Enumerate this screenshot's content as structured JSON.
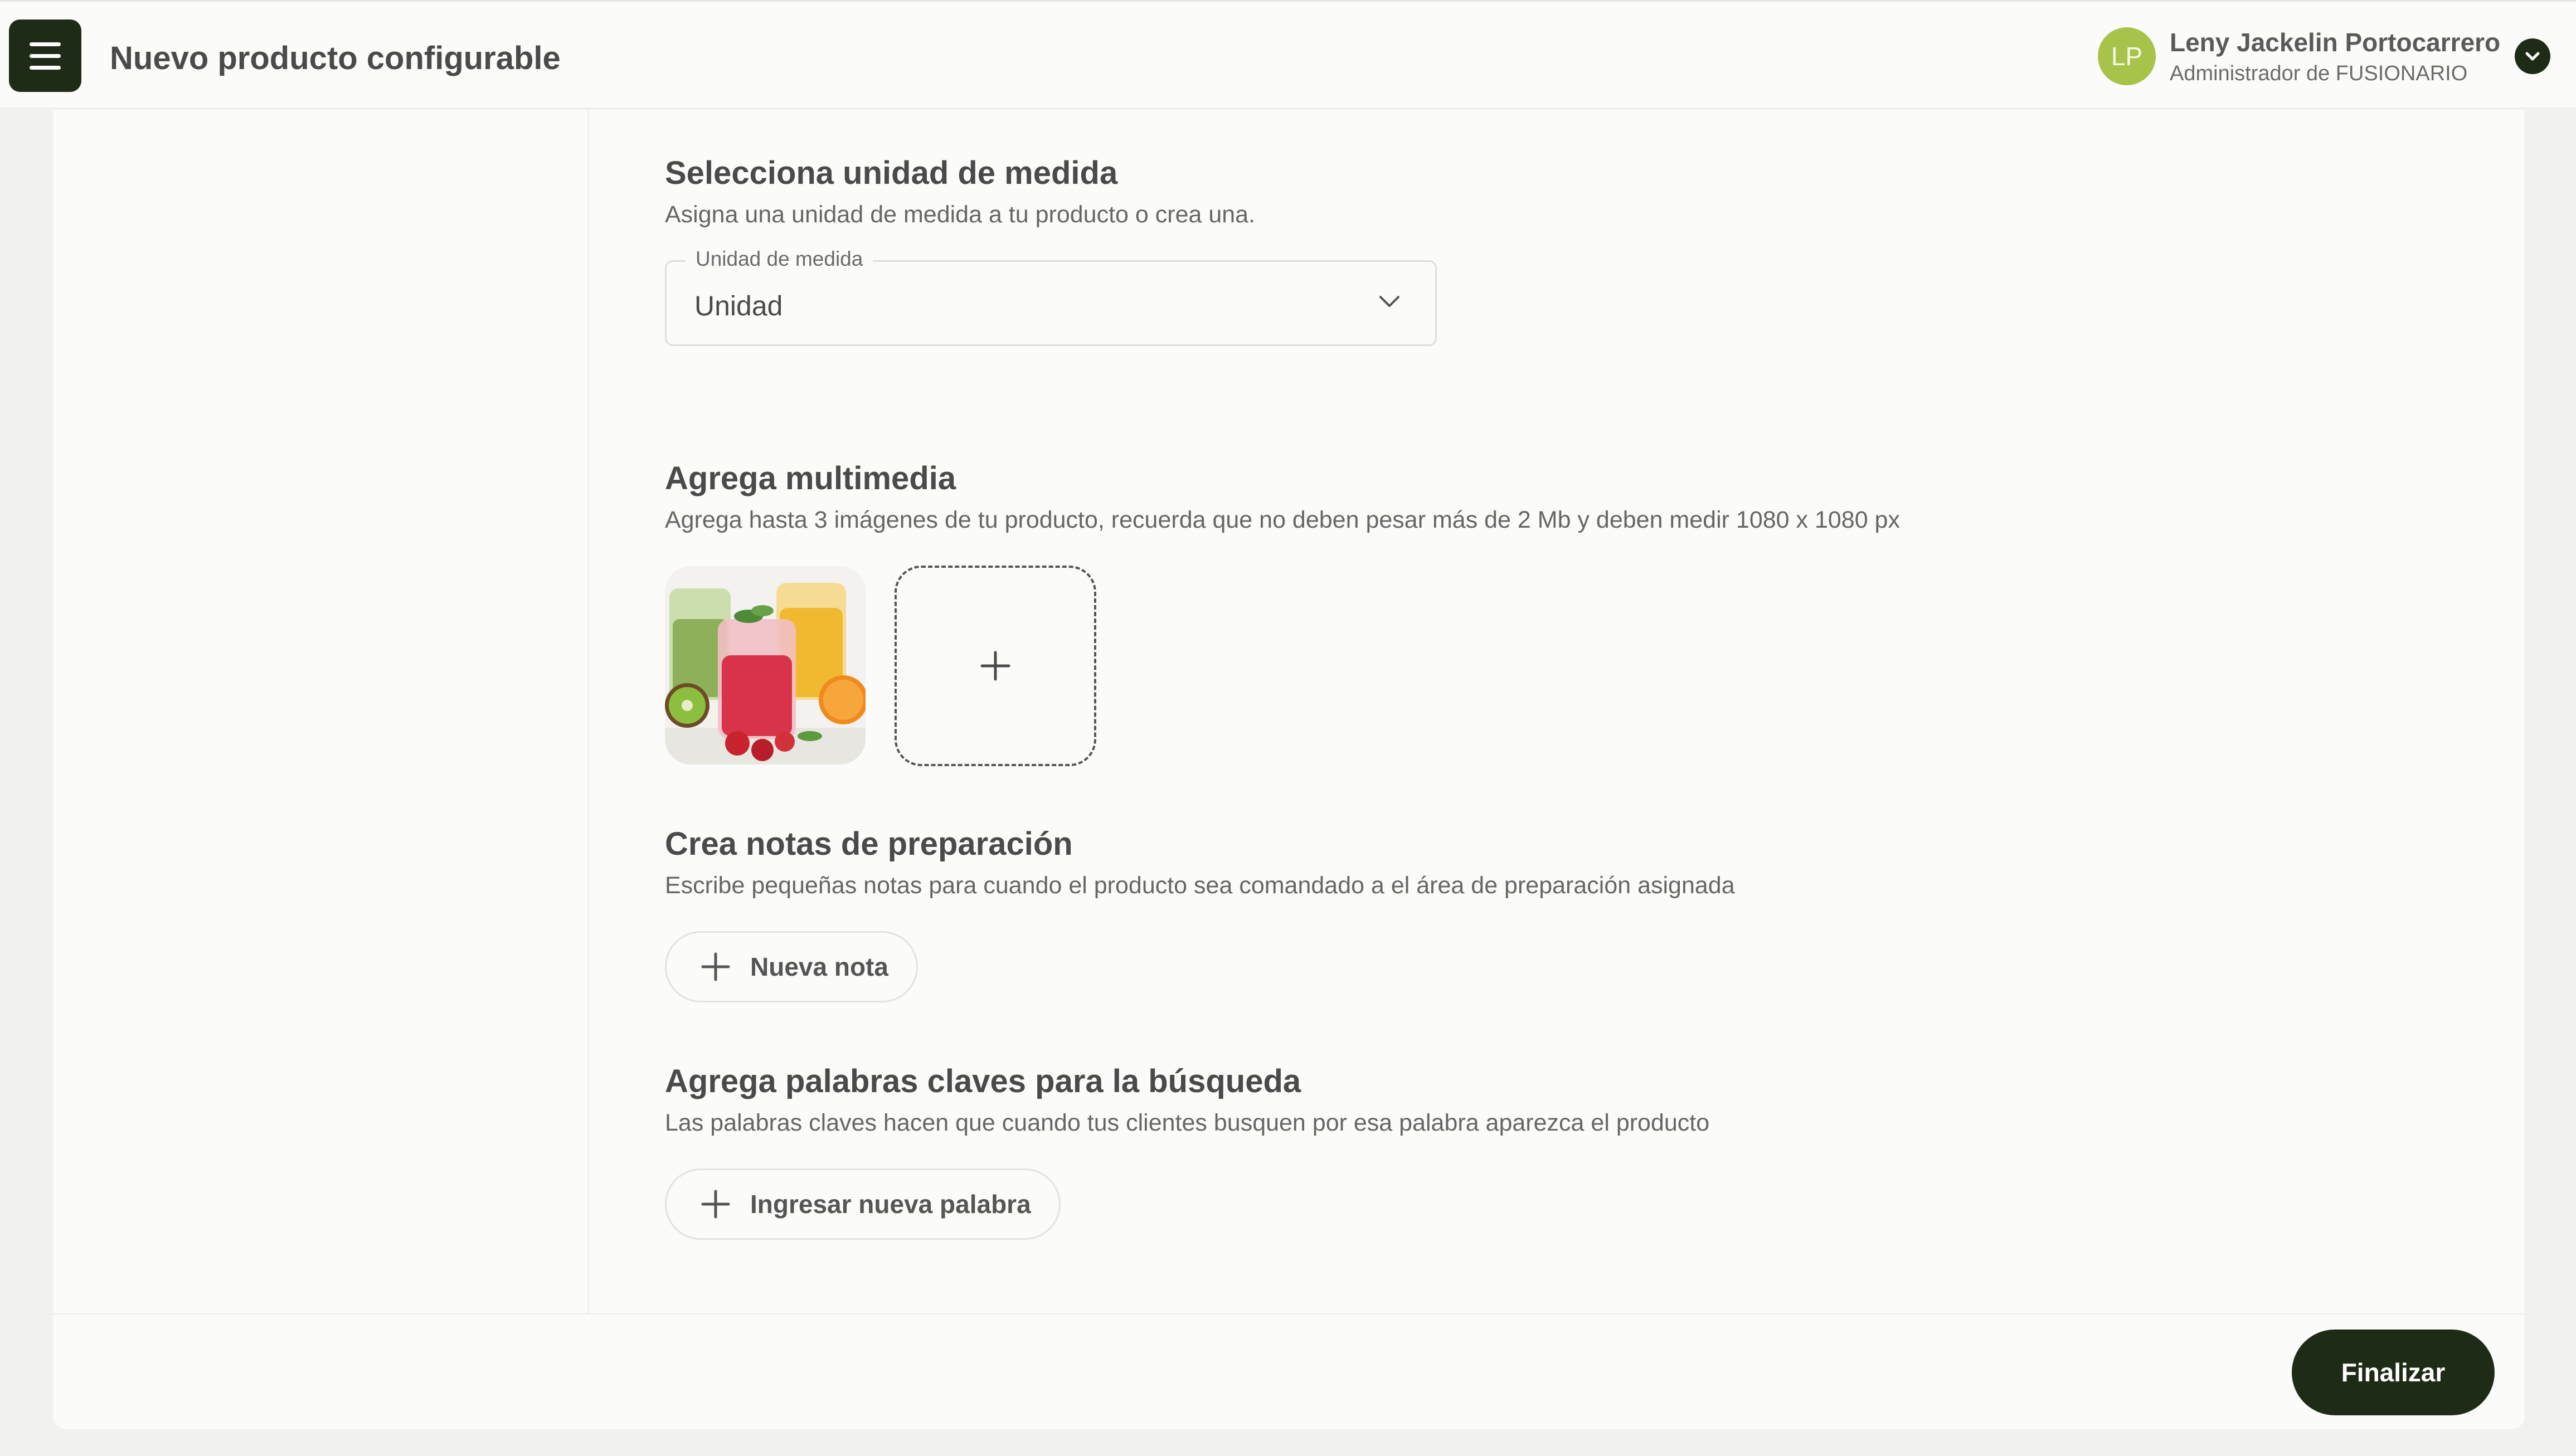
{
  "header": {
    "title": "Nuevo producto configurable",
    "user": {
      "initials": "LP",
      "name": "Leny Jackelin Portocarrero",
      "role": "Administrador de FUSIONARIO"
    }
  },
  "unit_section": {
    "title": "Selecciona unidad de medida",
    "description": "Asigna una unidad de medida a tu producto o crea una.",
    "field_label": "Unidad de medida",
    "selected_value": "Unidad"
  },
  "media_section": {
    "title": "Agrega multimedia",
    "description": "Agrega hasta 3 imágenes de tu producto, recuerda que no deben pesar más de 2 Mb y deben medir 1080 x 1080 px"
  },
  "notes_section": {
    "title": "Crea notas de preparación",
    "description": "Escribe pequeñas notas para cuando el producto sea comandado a el área de preparación asignada",
    "button_label": "Nueva nota"
  },
  "keywords_section": {
    "title": "Agrega palabras claves para la búsqueda",
    "description": "Las palabras claves hacen que cuando tus clientes busquen por esa palabra aparezca el producto",
    "button_label": "Ingresar nueva palabra"
  },
  "footer": {
    "finish_label": "Finalizar"
  },
  "colors": {
    "primary": "#1e2b17",
    "avatar": "#a8c34a",
    "background": "#f1f1ef",
    "surface": "#fbfbf9"
  },
  "icons": [
    "menu-icon",
    "chevron-down-icon",
    "plus-icon"
  ]
}
